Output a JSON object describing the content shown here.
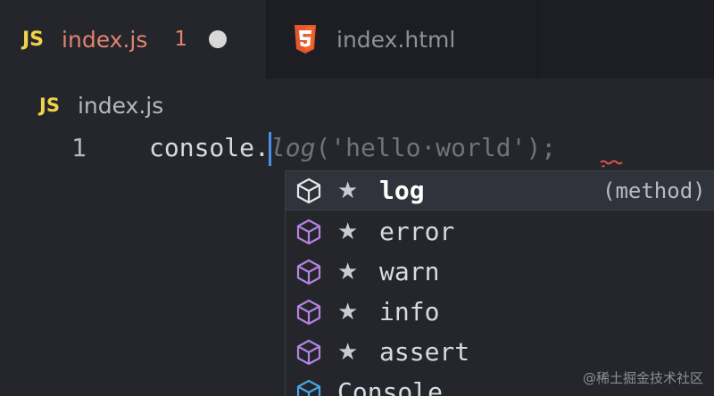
{
  "tabs": [
    {
      "badge": "JS",
      "title": "index.js",
      "problems": "1",
      "dirty": true,
      "active": true
    },
    {
      "badge": "html5-icon",
      "title": "index.html",
      "active": false
    }
  ],
  "breadcrumb": {
    "badge": "JS",
    "file": "index.js"
  },
  "editor": {
    "line_number": "1",
    "typed": "console.",
    "ghost_italic": "log",
    "ghost_rest": "('hello·world');"
  },
  "suggestions": [
    {
      "star": "★",
      "label": "log",
      "detail": "(method)",
      "icon": "method-cube-icon",
      "selected": true
    },
    {
      "star": "★",
      "label": "error",
      "icon": "method-cube-icon"
    },
    {
      "star": "★",
      "label": "warn",
      "icon": "method-cube-icon"
    },
    {
      "star": "★",
      "label": "info",
      "icon": "method-cube-icon"
    },
    {
      "star": "★",
      "label": "assert",
      "icon": "method-cube-icon"
    },
    {
      "label": "Console",
      "icon": "class-cube-icon"
    }
  ],
  "watermark": "@稀土掘金技术社区",
  "colors": {
    "js_badge": "#f0d34a",
    "active_tab_text": "#e2836e",
    "cursor": "#4d8fe8",
    "method_icon": "#b483e0",
    "class_icon": "#4aa3e6",
    "squiggle": "#e05050"
  }
}
